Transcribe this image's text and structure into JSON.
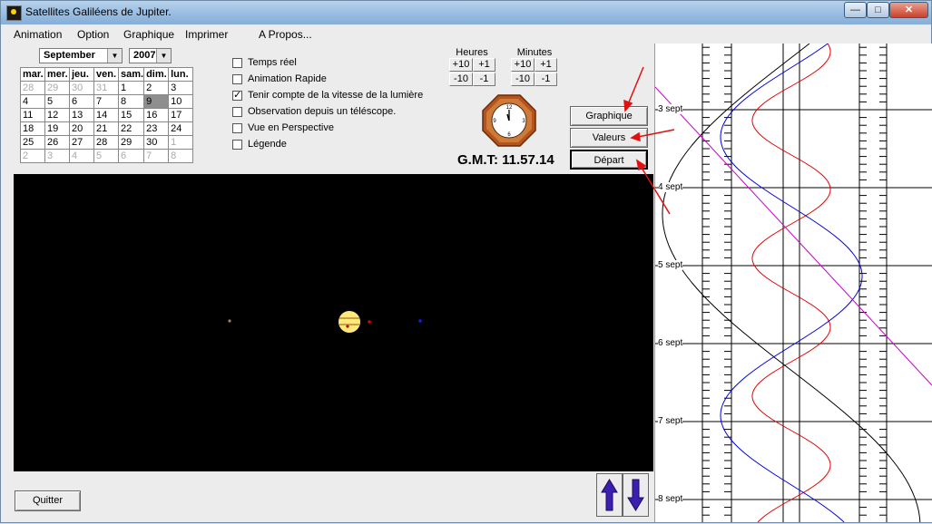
{
  "window": {
    "title": "Satellites Galiléens de Jupiter."
  },
  "menu": [
    "Animation",
    "Option",
    "Graphique",
    "Imprimer",
    "A Propos..."
  ],
  "date": {
    "month": "September",
    "year": "2007"
  },
  "calendar": {
    "headers": [
      "mar.",
      "mer.",
      "jeu.",
      "ven.",
      "sam.",
      "dim.",
      "lun."
    ],
    "rows": [
      [
        "28",
        "29",
        "30",
        "31",
        "1",
        "2",
        "3"
      ],
      [
        "4",
        "5",
        "6",
        "7",
        "8",
        "9",
        "10"
      ],
      [
        "11",
        "12",
        "13",
        "14",
        "15",
        "16",
        "17"
      ],
      [
        "18",
        "19",
        "20",
        "21",
        "22",
        "23",
        "24"
      ],
      [
        "25",
        "26",
        "27",
        "28",
        "29",
        "30",
        "1"
      ],
      [
        "2",
        "3",
        "4",
        "5",
        "6",
        "7",
        "8"
      ]
    ],
    "selected_day": "9"
  },
  "options": [
    {
      "label": "Temps réel",
      "checked": false
    },
    {
      "label": "Animation Rapide",
      "checked": false
    },
    {
      "label": "Tenir compte de la vitesse de la lumière",
      "checked": true
    },
    {
      "label": "Observation depuis un téléscope.",
      "checked": false
    },
    {
      "label": "Vue en Perspective",
      "checked": false
    },
    {
      "label": "Légende",
      "checked": false
    }
  ],
  "time": {
    "hours_label": "Heures",
    "minutes_label": "Minutes",
    "plus10": "+10",
    "plus1": "+1",
    "minus10": "-10",
    "minus1": "-1"
  },
  "gmt": "G.M.T: 11.57.14",
  "buttons": {
    "graph": "Graphique",
    "values": "Valeurs",
    "start": "Départ",
    "quit": "Quitter"
  },
  "graph_dates": [
    "3 sept",
    "4 sept",
    "5 sept",
    "6 sept",
    "7 sept",
    "8 sept"
  ],
  "colors": {
    "io": "#e00000",
    "europa": "#0000e0",
    "callisto": "#000000",
    "ganymede": "#cc00cc",
    "jupiter": "#ffe97a"
  },
  "icons": [
    "app-icon",
    "clock-icon",
    "arrow-up-icon",
    "arrow-down-icon"
  ]
}
